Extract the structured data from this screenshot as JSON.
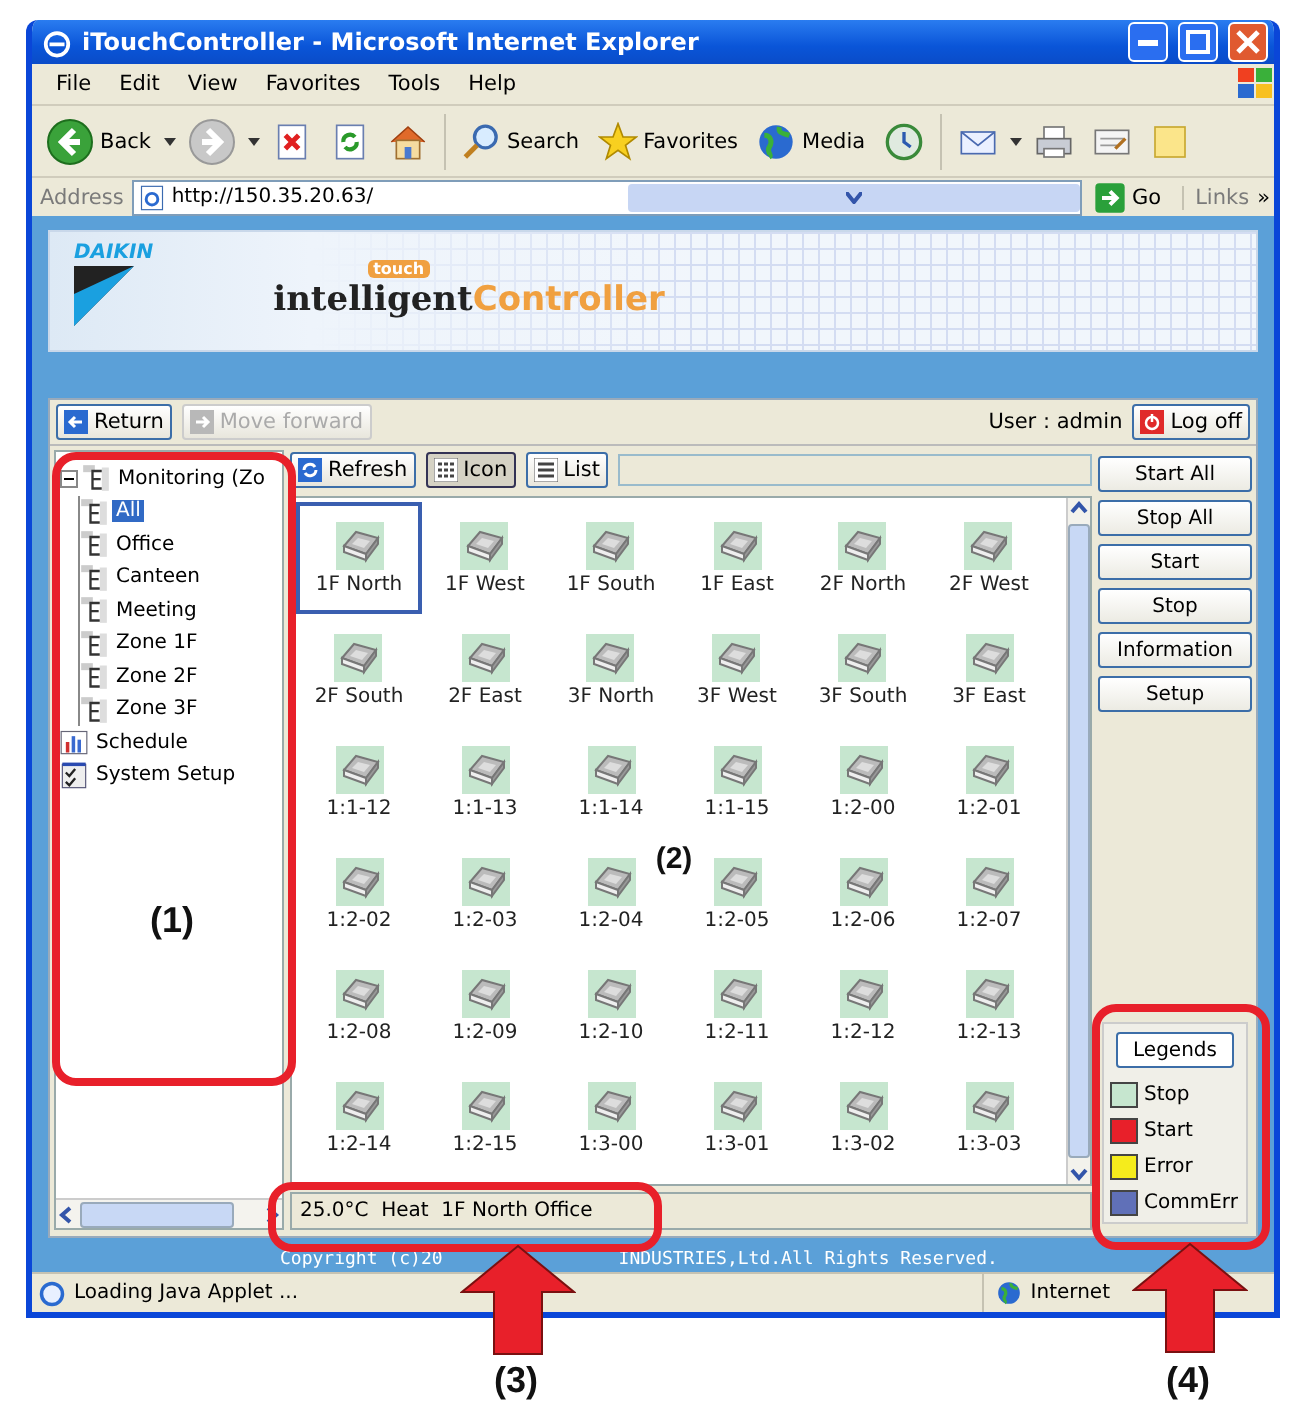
{
  "window": {
    "title": "iTouchController - Microsoft Internet Explorer"
  },
  "menu": [
    "File",
    "Edit",
    "View",
    "Favorites",
    "Tools",
    "Help"
  ],
  "toolbar": [
    {
      "kind": "back",
      "label": "Back"
    },
    {
      "kind": "forward"
    },
    {
      "kind": "stop"
    },
    {
      "kind": "refresh"
    },
    {
      "kind": "home"
    },
    {
      "kind": "separator"
    },
    {
      "kind": "search",
      "label": "Search"
    },
    {
      "kind": "favorites",
      "label": "Favorites"
    },
    {
      "kind": "media",
      "label": "Media"
    },
    {
      "kind": "history"
    },
    {
      "kind": "separator"
    },
    {
      "kind": "mail"
    },
    {
      "kind": "print"
    },
    {
      "kind": "edit"
    },
    {
      "kind": "note"
    }
  ],
  "address": {
    "label": "Address",
    "url": "http://150.35.20.63/",
    "go": "Go",
    "links": "Links",
    "more": "»"
  },
  "banner": {
    "brand": "DAIKIN",
    "logo_main": "intelligent",
    "logo_badge": "touch",
    "logo_tail": "Controller"
  },
  "nav": {
    "return": "Return",
    "forward": {
      "label": "Move forward",
      "disabled": true
    },
    "user": "User : admin",
    "logoff": "Log off"
  },
  "tree": [
    {
      "kind": "group",
      "label": "Monitoring (Zo",
      "selected": false,
      "expanded": true,
      "children": [
        {
          "kind": "group",
          "label": "All",
          "selected": true
        },
        {
          "kind": "group",
          "label": "Office",
          "selected": false
        },
        {
          "kind": "group",
          "label": "Canteen",
          "selected": false
        },
        {
          "kind": "group",
          "label": "Meeting",
          "selected": false
        },
        {
          "kind": "group",
          "label": "Zone 1F",
          "selected": false
        },
        {
          "kind": "group",
          "label": "Zone 2F",
          "selected": false
        },
        {
          "kind": "group",
          "label": "Zone 3F",
          "selected": false
        }
      ]
    },
    {
      "kind": "schedule",
      "label": "Schedule",
      "selected": false
    },
    {
      "kind": "setup",
      "label": "System Setup",
      "selected": false
    }
  ],
  "view_buttons": [
    {
      "kind": "refresh",
      "label": "Refresh",
      "selected": false
    },
    {
      "kind": "icon",
      "label": "Icon",
      "selected": true
    },
    {
      "kind": "list",
      "label": "List",
      "selected": false
    }
  ],
  "units": [
    {
      "name": "1F North",
      "selected": true
    },
    {
      "name": "1F West",
      "selected": false
    },
    {
      "name": "1F South",
      "selected": false
    },
    {
      "name": "1F East",
      "selected": false
    },
    {
      "name": "2F North",
      "selected": false
    },
    {
      "name": "2F West",
      "selected": false
    },
    {
      "name": "2F South",
      "selected": false
    },
    {
      "name": "2F East",
      "selected": false
    },
    {
      "name": "3F North",
      "selected": false
    },
    {
      "name": "3F West",
      "selected": false
    },
    {
      "name": "3F South",
      "selected": false
    },
    {
      "name": "3F East",
      "selected": false
    },
    {
      "name": "1:1-12",
      "selected": false
    },
    {
      "name": "1:1-13",
      "selected": false
    },
    {
      "name": "1:1-14",
      "selected": false
    },
    {
      "name": "1:1-15",
      "selected": false
    },
    {
      "name": "1:2-00",
      "selected": false
    },
    {
      "name": "1:2-01",
      "selected": false
    },
    {
      "name": "1:2-02",
      "selected": false
    },
    {
      "name": "1:2-03",
      "selected": false
    },
    {
      "name": "1:2-04",
      "selected": false
    },
    {
      "name": "1:2-05",
      "selected": false
    },
    {
      "name": "1:2-06",
      "selected": false
    },
    {
      "name": "1:2-07",
      "selected": false
    },
    {
      "name": "1:2-08",
      "selected": false
    },
    {
      "name": "1:2-09",
      "selected": false
    },
    {
      "name": "1:2-10",
      "selected": false
    },
    {
      "name": "1:2-11",
      "selected": false
    },
    {
      "name": "1:2-12",
      "selected": false
    },
    {
      "name": "1:2-13",
      "selected": false
    },
    {
      "name": "1:2-14",
      "selected": false
    },
    {
      "name": "1:2-15",
      "selected": false
    },
    {
      "name": "1:3-00",
      "selected": false
    },
    {
      "name": "1:3-01",
      "selected": false
    },
    {
      "name": "1:3-02",
      "selected": false
    },
    {
      "name": "1:3-03",
      "selected": false
    }
  ],
  "actions": [
    "Start All",
    "Stop All",
    "Start",
    "Stop",
    "Information",
    "Setup"
  ],
  "legend": {
    "title": "Legends",
    "items": [
      {
        "label": "Stop",
        "color": "#c6e6cf"
      },
      {
        "label": "Start",
        "color": "#e8202a"
      },
      {
        "label": "Error",
        "color": "#f5ec1c"
      },
      {
        "label": "CommErr",
        "color": "#6070b8"
      }
    ]
  },
  "status_field": "25.0°C  Heat  1F North Office",
  "copyright": [
    "Copyright (c)20",
    "INDUSTRIES,Ltd.All Rights Reserved."
  ],
  "status_bar": {
    "text": "Loading Java Applet ...",
    "zone": "Internet"
  },
  "callouts": [
    {
      "kind": "frame",
      "label": "(1)"
    },
    {
      "kind": "plain",
      "label": "(2)"
    },
    {
      "kind": "arrow",
      "label": "(3)"
    },
    {
      "kind": "arrow",
      "label": "(4)"
    }
  ]
}
